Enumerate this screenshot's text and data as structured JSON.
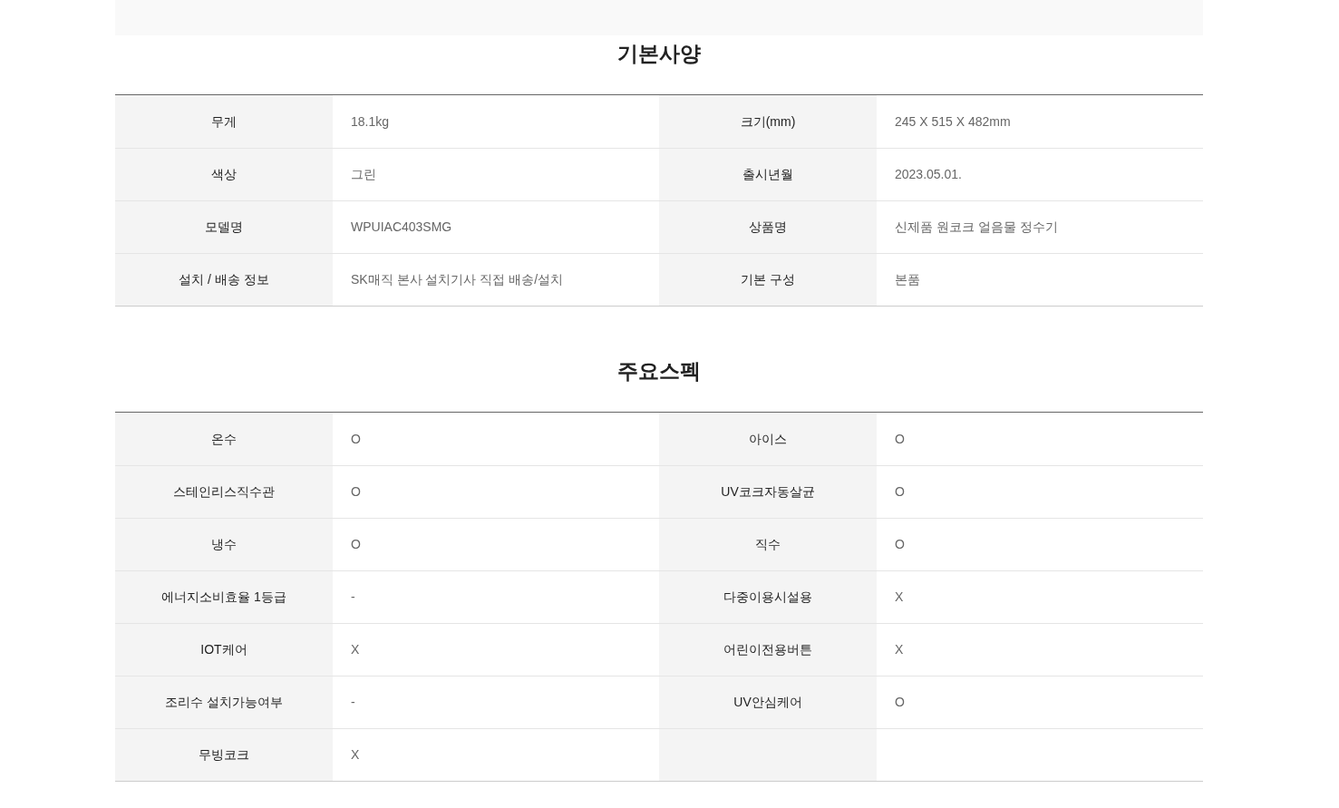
{
  "sections": [
    {
      "title": "기본사양",
      "rows": [
        {
          "label": "무게",
          "value": "18.1kg"
        },
        {
          "label": "크기(mm)",
          "value": "245 X 515 X 482mm"
        },
        {
          "label": "색상",
          "value": "그린"
        },
        {
          "label": "출시년월",
          "value": "2023.05.01."
        },
        {
          "label": "모델명",
          "value": "WPUIAC403SMG"
        },
        {
          "label": "상품명",
          "value": "신제품 원코크 얼음물 정수기"
        },
        {
          "label": "설치 / 배송 정보",
          "value": "SK매직 본사 설치기사 직접 배송/설치"
        },
        {
          "label": "기본 구성",
          "value": "본품"
        }
      ]
    },
    {
      "title": "주요스펙",
      "rows": [
        {
          "label": "온수",
          "value": "O"
        },
        {
          "label": "아이스",
          "value": "O"
        },
        {
          "label": "스테인리스직수관",
          "value": "O"
        },
        {
          "label": "UV코크자동살균",
          "value": "O"
        },
        {
          "label": "냉수",
          "value": "O"
        },
        {
          "label": "직수",
          "value": "O"
        },
        {
          "label": "에너지소비효율 1등급",
          "value": "-"
        },
        {
          "label": "다중이용시설용",
          "value": "X"
        },
        {
          "label": "IOT케어",
          "value": "X"
        },
        {
          "label": "어린이전용버튼",
          "value": "X"
        },
        {
          "label": "조리수 설치가능여부",
          "value": "-"
        },
        {
          "label": "UV안심케어",
          "value": "O"
        },
        {
          "label": "무빙코크",
          "value": "X"
        }
      ]
    }
  ]
}
